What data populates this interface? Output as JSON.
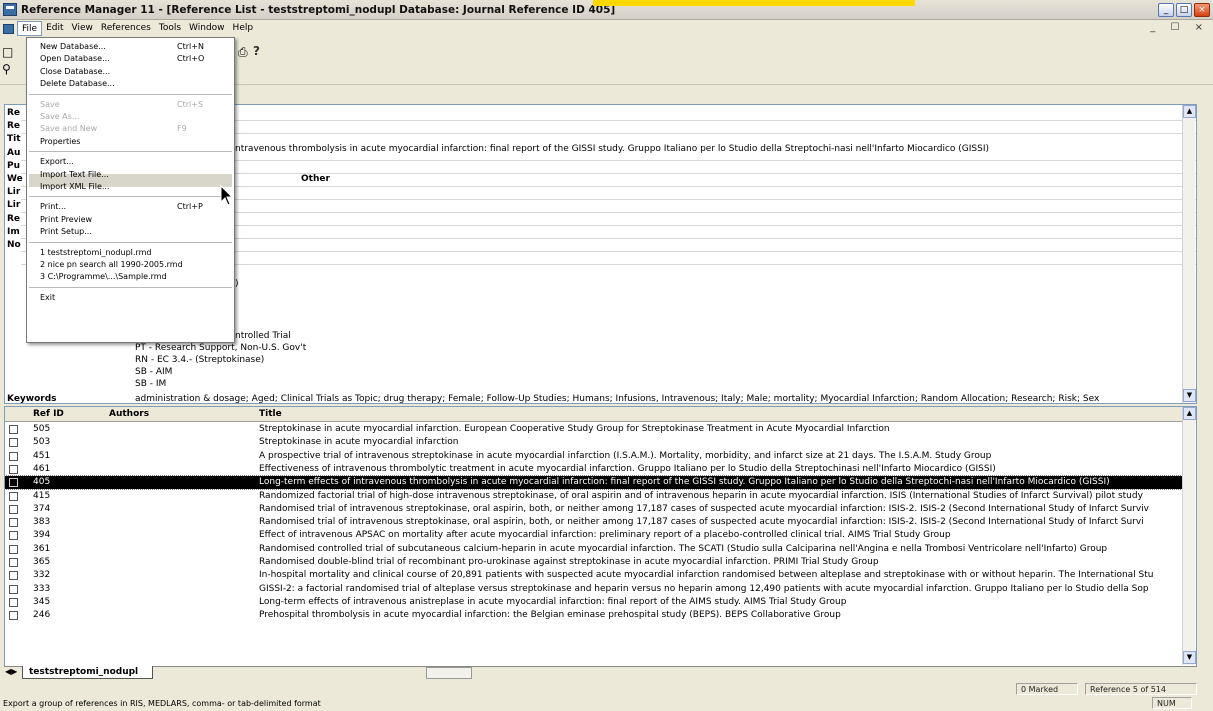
{
  "window": {
    "title": "Reference Manager 11 - [Reference List - teststreptomi_nodupl Database: Journal Reference ID 405]",
    "min": "_",
    "max": "□",
    "close": "×"
  },
  "menubar": {
    "items": [
      "File",
      "Edit",
      "View",
      "References",
      "Tools",
      "Window",
      "Help"
    ],
    "mdi_controls": "_ ☐ ×"
  },
  "file_menu": {
    "groups": [
      [
        {
          "label": "New Database...",
          "shortcut": "Ctrl+N",
          "disabled": false
        },
        {
          "label": "Open Database...",
          "shortcut": "Ctrl+O",
          "disabled": false
        },
        {
          "label": "Close Database...",
          "shortcut": "",
          "disabled": false
        },
        {
          "label": "Delete Database...",
          "shortcut": "",
          "disabled": false
        }
      ],
      [
        {
          "label": "Save",
          "shortcut": "Ctrl+S",
          "disabled": true
        },
        {
          "label": "Save As...",
          "shortcut": "",
          "disabled": true
        },
        {
          "label": "Save and New",
          "shortcut": "F9",
          "disabled": true
        },
        {
          "label": "Properties",
          "shortcut": "",
          "disabled": false
        }
      ],
      [
        {
          "label": "Export...",
          "shortcut": "",
          "disabled": false,
          "highlighted": true
        },
        {
          "label": "Import Text File...",
          "shortcut": "",
          "disabled": false
        },
        {
          "label": "Import XML File...",
          "shortcut": "",
          "disabled": false
        }
      ],
      [
        {
          "label": "Print...",
          "shortcut": "Ctrl+P",
          "disabled": false
        },
        {
          "label": "Print Preview",
          "shortcut": "",
          "disabled": false
        },
        {
          "label": "Print Setup...",
          "shortcut": "",
          "disabled": false
        }
      ],
      [
        {
          "label": "1 teststreptomi_nodupl.rmd",
          "shortcut": "",
          "disabled": false
        },
        {
          "label": "2 nice pn search all 1990-2005.rmd",
          "shortcut": "",
          "disabled": false
        },
        {
          "label": "3 C:\\Programme\\...\\Sample.rmd",
          "shortcut": "",
          "disabled": false
        }
      ],
      [
        {
          "label": "Exit",
          "shortcut": "",
          "disabled": false
        }
      ]
    ]
  },
  "detail": {
    "labels": [
      "Re",
      "Re",
      "Tit",
      "Au",
      "Pu",
      "We",
      "Lir",
      "Lir",
      "Re",
      "Im",
      "No"
    ],
    "title_text": "ntravenous thrombolysis in acute myocardial infarction: final report of the GISSI study. Gruppo Italiano per lo Studio della Streptochi-nasi nell'Infarto Miocardico (GISSI)",
    "other_label": "Other",
    "paren": ")",
    "notes": [
      "ntrolled Trial",
      "PT - Research Support, Non-U.S. Gov't",
      "RN - EC 3.4.- (Streptokinase)",
      "SB - AIM",
      "SB - IM"
    ],
    "keywords_label": "Keywords",
    "keywords": "administration & dosage; Aged; Clinical Trials as Topic; drug therapy; Female; Follow-Up Studies; Humans; Infusions, Intravenous; Italy; Male; mortality; Myocardial Infarction; Random Allocation; Research; Risk; Sex"
  },
  "list": {
    "columns": [
      "Ref ID",
      "Authors",
      "Title"
    ],
    "rows": [
      {
        "id": "505",
        "title": "Streptokinase in acute myocardial infarction. European Cooperative Study Group for Streptokinase Treatment in Acute Myocardial Infarction"
      },
      {
        "id": "503",
        "title": "Streptokinase in acute myocardial infarction"
      },
      {
        "id": "451",
        "title": "A prospective trial of intravenous streptokinase in acute myocardial infarction (I.S.A.M.). Mortality, morbidity, and infarct size at 21 days. The I.S.A.M. Study Group"
      },
      {
        "id": "461",
        "title": "Effectiveness of intravenous thrombolytic treatment in acute myocardial infarction. Gruppo Italiano per lo Studio della Streptochinasi nell'Infarto Miocardico (GISSI)"
      },
      {
        "id": "405",
        "title": "Long-term effects of intravenous thrombolysis in acute myocardial infarction: final report of the GISSI study. Gruppo Italiano per lo Studio della Streptochi-nasi nell'Infarto Miocardico (GISSI)",
        "selected": true
      },
      {
        "id": "415",
        "title": "Randomized factorial trial of high-dose intravenous streptokinase, of oral aspirin and of intravenous heparin in acute myocardial infarction. ISIS (International Studies of Infarct Survival) pilot study"
      },
      {
        "id": "374",
        "title": "Randomised trial of intravenous streptokinase, oral aspirin, both, or neither among 17,187 cases of suspected acute myocardial infarction: ISIS-2. ISIS-2 (Second International Study of Infarct Surviv"
      },
      {
        "id": "383",
        "title": "Randomised trial of intravenous streptokinase, oral aspirin, both, or neither among 17,187 cases of suspected acute myocardial infarction: ISIS-2. ISIS-2 (Second International Study of Infarct Survi"
      },
      {
        "id": "394",
        "title": "Effect of intravenous APSAC on mortality after acute myocardial infarction: preliminary report of a placebo-controlled clinical trial. AIMS Trial Study Group"
      },
      {
        "id": "361",
        "title": "Randomised controlled trial of subcutaneous calcium-heparin in acute myocardial infarction. The SCATI (Studio sulla Calciparina nell'Angina e nella Trombosi Ventricolare nell'Infarto) Group"
      },
      {
        "id": "365",
        "title": "Randomised double-blind trial of recombinant pro-urokinase against streptokinase in acute myocardial infarction. PRIMI Trial Study Group"
      },
      {
        "id": "332",
        "title": "In-hospital mortality and clinical course of 20,891 patients with suspected acute myocardial infarction randomised between alteplase and streptokinase with or without heparin. The International Stu"
      },
      {
        "id": "333",
        "title": "GISSI-2: a factorial randomised trial of alteplase versus streptokinase and heparin versus no heparin among 12,490 patients with acute myocardial infarction. Gruppo Italiano per lo Studio della Sop"
      },
      {
        "id": "345",
        "title": "Long-term effects of intravenous anistreplase in acute myocardial infarction: final report of the AIMS study. AIMS Trial Study Group"
      },
      {
        "id": "246",
        "title": "Prehospital thrombolysis in acute myocardial infarction: the Belgian eminase prehospital study (BEPS). BEPS Collaborative Group"
      }
    ]
  },
  "tab": {
    "label": "teststreptomi_nodupl"
  },
  "status": {
    "marked": "0 Marked",
    "reference": "Reference 5 of 514",
    "hint": "Export a group of references in RIS, MEDLARS, comma- or tab-delimited format",
    "num": "NUM"
  },
  "icons": [
    "app-icon",
    "search-icon",
    "print-icon",
    "help-icon",
    "mouse-cursor-icon"
  ]
}
